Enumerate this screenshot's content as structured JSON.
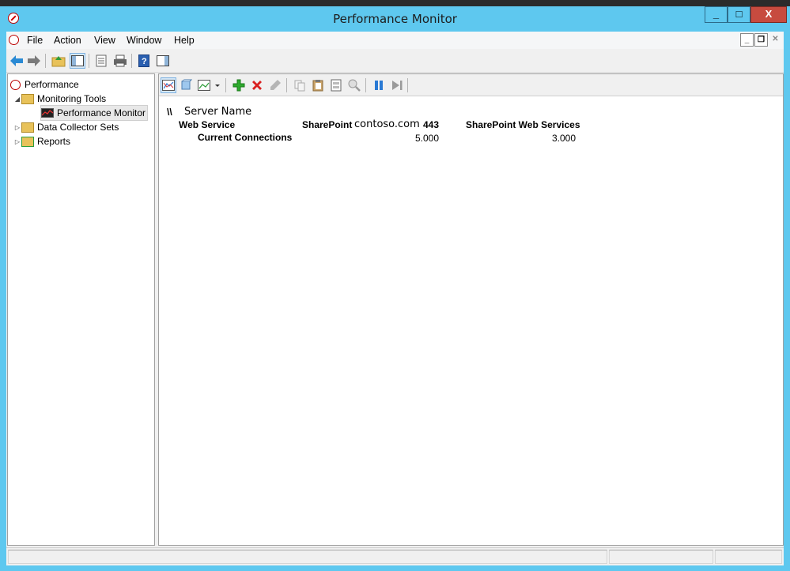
{
  "window": {
    "title": "Performance Monitor",
    "minimize_label": "_",
    "maximize_label": "□",
    "close_label": "X"
  },
  "menubar": {
    "items": [
      "File",
      "Action",
      "View",
      "Window",
      "Help"
    ],
    "mdi_minimize": "_",
    "mdi_restore": "❐",
    "mdi_close": "✕"
  },
  "toolbar": {
    "buttons": [
      "back-icon",
      "forward-icon",
      "up-folder-icon",
      "show-hide-tree-icon",
      "properties-icon",
      "print-icon",
      "help-icon",
      "show-hide-action-pane-icon"
    ]
  },
  "tree": {
    "root": "Performance",
    "items": [
      {
        "label": "Monitoring Tools",
        "expander": "◢"
      },
      {
        "label": "Performance Monitor"
      },
      {
        "label": "Data Collector Sets",
        "expander": "▷"
      },
      {
        "label": "Reports",
        "expander": "▷"
      }
    ]
  },
  "pm_toolbar": {
    "buttons": [
      "view-current-activity-icon",
      "view-log-data-icon",
      "change-graph-type-icon",
      "add-counter-icon",
      "delete-counter-icon",
      "highlight-icon",
      "copy-properties-icon",
      "paste-counter-list-icon",
      "properties-icon",
      "zoom-icon",
      "freeze-display-icon",
      "update-data-icon"
    ]
  },
  "report": {
    "server_prefix": "\\\\",
    "server_name": "Server Name",
    "object": "Web Service",
    "instance_1_prefix": "SharePoint",
    "instance_1_host": "contoso.com",
    "instance_1_port": "443",
    "instance_2": "SharePoint Web Services",
    "counter": "Current Connections",
    "value_1": "5.000",
    "value_2": "3.000"
  },
  "colors": {
    "window_chrome": "#5ec8ef",
    "close_button": "#c74b3f"
  }
}
